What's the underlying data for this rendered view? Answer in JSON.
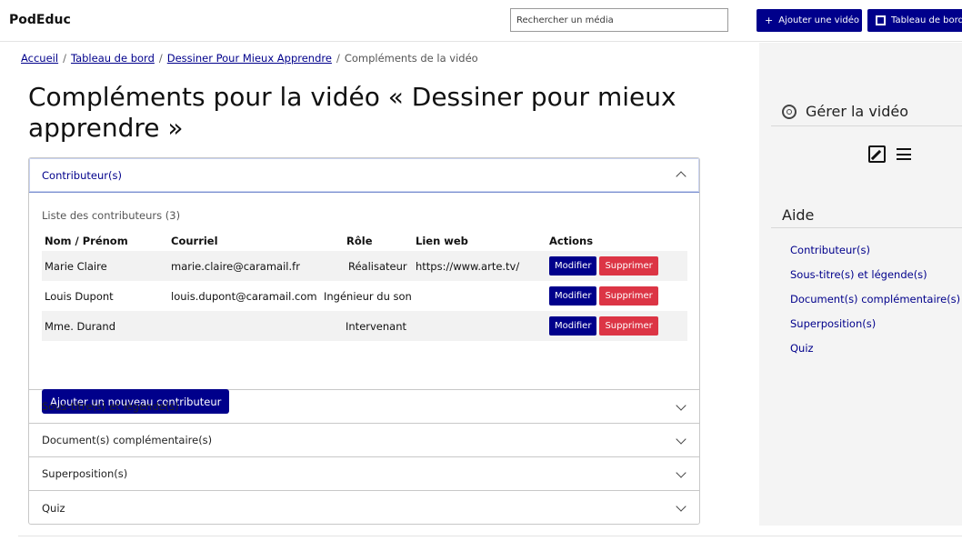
{
  "app": {
    "brand": "PodEduc"
  },
  "search": {
    "placeholder": "Rechercher un média"
  },
  "topbar": {
    "add_video": "Ajouter une vidéo",
    "dashboard": "Tableau de bord"
  },
  "breadcrumb": [
    "Accueil",
    "Tableau de bord",
    "Dessiner Pour Mieux Apprendre",
    "Compléments de la vidéo"
  ],
  "title": "Compléments pour la vidéo « Dessiner pour mieux apprendre »",
  "accordion": {
    "contributors": {
      "label": "Contributeur(s)",
      "list_title": "Liste des contributeurs (3)",
      "columns": [
        "Nom / Prénom",
        "Courriel",
        "Rôle",
        "Lien web",
        "Actions"
      ],
      "rows": [
        {
          "name": "Marie Claire",
          "email": "marie.claire@caramail.fr",
          "role": "Réalisateur",
          "web": "https://www.arte.tv/"
        },
        {
          "name": "Louis Dupont",
          "email": "louis.dupont@caramail.com",
          "role": "Ingénieur du son",
          "web": ""
        },
        {
          "name": "Mme. Durand",
          "email": "",
          "role": "Intervenant",
          "web": ""
        }
      ],
      "edit_label": "Modifier",
      "delete_label": "Supprimer",
      "add_label": "Ajouter un nouveau contributeur"
    },
    "others": [
      "Sous-titre(s) et légende(s)",
      "Document(s) complémentaire(s)",
      "Superposition(s)",
      "Quiz"
    ]
  },
  "sidebar": {
    "manage_title": "Gérer la vidéo",
    "help_title": "Aide",
    "help_links": [
      "Contributeur(s)",
      "Sous-titre(s) et légende(s)",
      "Document(s) complémentaire(s)",
      "Superposition(s)",
      "Quiz"
    ]
  },
  "colors": {
    "primary": "#00008b",
    "danger": "#dc3545"
  }
}
